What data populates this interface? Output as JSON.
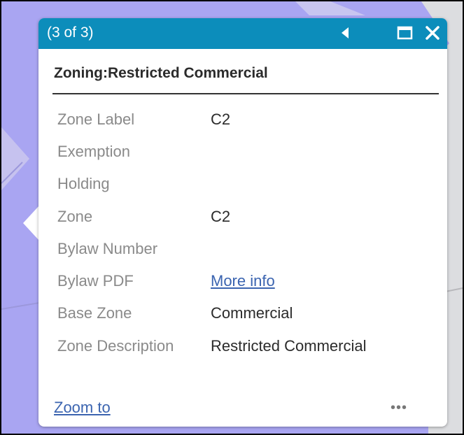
{
  "popup": {
    "counter": "(3 of 3)",
    "heading": "Zoning:Restricted Commercial",
    "attributes": [
      {
        "label": "Zone Label",
        "value": "C2"
      },
      {
        "label": "Exemption",
        "value": ""
      },
      {
        "label": "Holding",
        "value": ""
      },
      {
        "label": "Zone",
        "value": "C2"
      },
      {
        "label": "Bylaw Number",
        "value": ""
      },
      {
        "label": "Bylaw PDF",
        "value": "More info"
      },
      {
        "label": "Base Zone",
        "value": "Commercial"
      },
      {
        "label": "Zone Description",
        "value": "Restricted Commercial"
      }
    ],
    "zoom_label": "Zoom to",
    "more_label": "•••"
  },
  "colors": {
    "map_zone": "#a9a5f2",
    "titlebar": "#0c8dbb",
    "link": "#3b64b0"
  },
  "icons": [
    "previous-arrow-icon",
    "maximize-icon",
    "close-icon",
    "more-actions-icon"
  ]
}
